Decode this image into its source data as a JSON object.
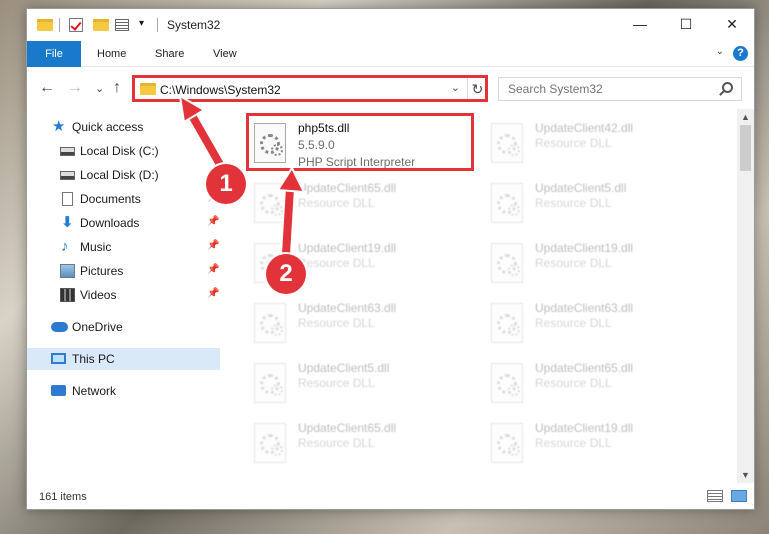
{
  "window": {
    "title": "System32",
    "controls": {
      "minimize": "—",
      "maximize": "☐",
      "close": "✕"
    },
    "qa_toolbar_chevron": "▾"
  },
  "ribbon": {
    "tabs": [
      "File",
      "Home",
      "Share",
      "View"
    ],
    "collapse_chevron": "⌄",
    "help": "?"
  },
  "nav": {
    "back": "←",
    "forward": "→",
    "recent": "⌄",
    "up": "↑",
    "address_path": "C:\\Windows\\System32",
    "address_dropdown": "⌄",
    "refresh": "↻",
    "search_placeholder": "Search System32"
  },
  "sidebar": {
    "items": [
      {
        "label": "Quick access",
        "icon": "star-icon"
      },
      {
        "label": "Local Disk (C:)",
        "icon": "drive-icon"
      },
      {
        "label": "Local Disk (D:)",
        "icon": "drive-icon"
      },
      {
        "label": "Documents",
        "icon": "documents-icon"
      },
      {
        "label": "Downloads",
        "icon": "downloads-icon"
      },
      {
        "label": "Music",
        "icon": "music-icon"
      },
      {
        "label": "Pictures",
        "icon": "pictures-icon"
      },
      {
        "label": "Videos",
        "icon": "videos-icon"
      },
      {
        "label": "OneDrive",
        "icon": "cloud-icon"
      },
      {
        "label": "This PC",
        "icon": "computer-icon"
      },
      {
        "label": "Network",
        "icon": "network-icon"
      }
    ],
    "pin_glyph": "📌"
  },
  "files": {
    "highlighted": {
      "name": "php5ts.dll",
      "version": "5.5.9.0",
      "description": "PHP Script Interpreter"
    },
    "faded": [
      {
        "name": "UpdateClient42.dll",
        "type": "Resource DLL"
      },
      {
        "name": "UpdateClient65.dll",
        "type": "Resource DLL"
      },
      {
        "name": "UpdateClient5.dll",
        "type": "Resource DLL"
      },
      {
        "name": "UpdateClient19.dll",
        "type": "Resource DLL"
      },
      {
        "name": "UpdateClient19.dll",
        "type": "Resource DLL"
      },
      {
        "name": "UpdateClient63.dll",
        "type": "Resource DLL"
      },
      {
        "name": "UpdateClient63.dll",
        "type": "Resource DLL"
      },
      {
        "name": "UpdateClient5.dll",
        "type": "Resource DLL"
      },
      {
        "name": "UpdateClient65.dll",
        "type": "Resource DLL"
      },
      {
        "name": "UpdateClient65.dll",
        "type": "Resource DLL"
      },
      {
        "name": "UpdateClient19.dll",
        "type": "Resource DLL"
      }
    ]
  },
  "scrollbar": {
    "up": "▲",
    "down": "▼"
  },
  "status": {
    "item_count": "161 items"
  },
  "annotations": {
    "step1": "1",
    "step2": "2",
    "color": "#e3333a"
  }
}
